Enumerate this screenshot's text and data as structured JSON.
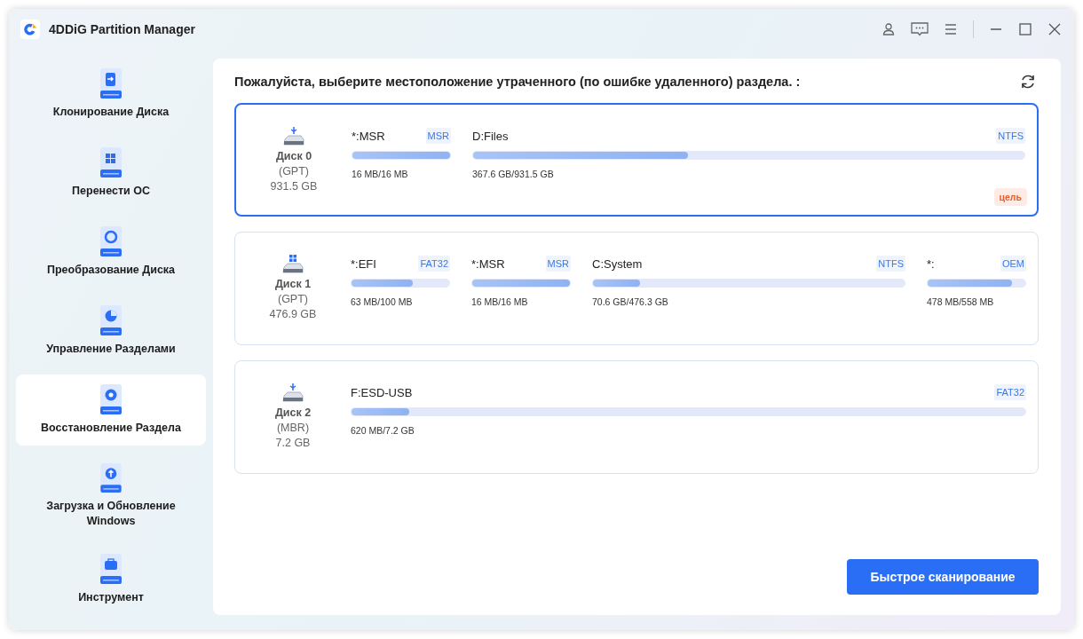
{
  "window": {
    "title": "4DDiG Partition Manager"
  },
  "sidebar": {
    "items": [
      {
        "label": "Клонирование Диска",
        "selected": false
      },
      {
        "label": "Перенести ОС",
        "selected": false
      },
      {
        "label": "Преобразование Диска",
        "selected": false
      },
      {
        "label": "Управление Разделами",
        "selected": false
      },
      {
        "label": "Восстановление Раздела",
        "selected": true
      },
      {
        "label": "Загрузка и Обновление Windows",
        "selected": false
      },
      {
        "label": "Инструмент",
        "selected": false
      }
    ]
  },
  "main": {
    "heading": "Пожалуйста, выберите местоположение утраченного (по ошибке удаленного) раздела. :",
    "disks": [
      {
        "kind": "usb",
        "name": "Диск 0",
        "scheme": "(GPT)",
        "size": "931.5 GB",
        "selected": true,
        "tag": "цель",
        "partitions": [
          {
            "kind": "fixed",
            "name": "*:MSR",
            "fs": "MSR",
            "level": 1.0,
            "usage": "16 MB/16 MB"
          },
          {
            "kind": "flex",
            "name": "D:Files",
            "fs": "NTFS",
            "level": 0.39,
            "usage": "367.6 GB/931.5 GB"
          }
        ]
      },
      {
        "kind": "windows",
        "name": "Диск 1",
        "scheme": "(GPT)",
        "size": "476.9 GB",
        "selected": false,
        "partitions": [
          {
            "kind": "fixed",
            "name": "*:EFI",
            "fs": "FAT32",
            "level": 0.63,
            "usage": "63 MB/100 MB"
          },
          {
            "kind": "fixed",
            "name": "*:MSR",
            "fs": "MSR",
            "level": 1.0,
            "usage": "16 MB/16 MB"
          },
          {
            "kind": "flex",
            "name": "C:System",
            "fs": "NTFS",
            "level": 0.15,
            "usage": "70.6 GB/476.3 GB"
          },
          {
            "kind": "fixed",
            "name": "*:",
            "fs": "OEM",
            "level": 0.86,
            "usage": "478 MB/558 MB"
          }
        ]
      },
      {
        "kind": "usb",
        "name": "Диск 2",
        "scheme": "(MBR)",
        "size": "7.2 GB",
        "selected": false,
        "partitions": [
          {
            "kind": "flex",
            "name": "F:ESD-USB",
            "fs": "FAT32",
            "level": 0.086,
            "usage": "620 MB/7.2 GB"
          }
        ]
      }
    ],
    "scan_button": "Быстрое сканирование"
  }
}
